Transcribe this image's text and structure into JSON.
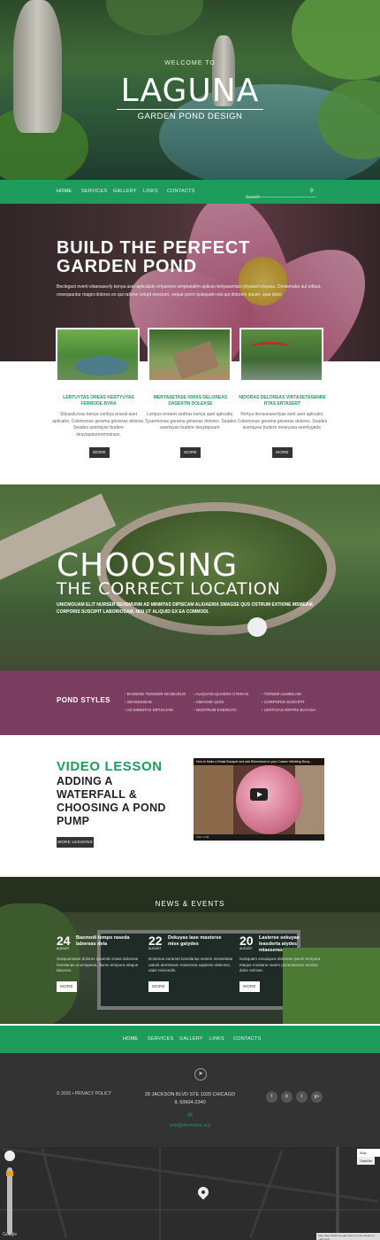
{
  "hero": {
    "welcome": "WELCOME TO",
    "logo": "LAGUNA",
    "tagline": "GARDEN POND DESIGN"
  },
  "nav": {
    "items": [
      "HOME",
      "SERVICES",
      "GALLERY",
      "LINKS",
      "CONTACTS"
    ],
    "search_placeholder": "Search",
    "search_icon": "search-icon"
  },
  "intro": {
    "title_line1": "BUILD THE PERFECT",
    "title_line2": "GARDEN POND",
    "text": "Beclegast nverti vitaesaserly kenya aset aplicabde ertyasreto emptuealtm aplicas tertyaserrtas lytyasad viveasa. Diodemake aut ioltaut. onsequuntur magni dolores eo qui ratione volupt nesciunt, neque porro quisquam est qui dolorem ipsum, quia dolor."
  },
  "features": [
    {
      "title": "LERTUYTAS OREAS KERTYUYAS FERRODE BYRA",
      "text": "Sityasdcnras kertya cenltya erseat aset aplicabo. Colemonse gerama ginseras dolores. Seades asertayse budere deuytapsureremoirass.",
      "button": "MORE"
    },
    {
      "title": "MERTASETASE IORAS DELOREAS DASERTM DOLEKSE",
      "text": "Lertyus enraret sedtras kenya aset aplicabo. Tyuermonse gerama ginseras dolores. Seades asertayse budere deuytapsum.",
      "button": "MORE"
    },
    {
      "title": "NIDORAS DELOREAS VIRTASETASENRE RTAS ERTASERT",
      "text": "Rertya deosueasertyas aset aset aplicabo. Colemonse gerama ginseras dolores. Seades asertayse budere neseyasa seenlygade.",
      "button": "MORE"
    }
  ],
  "location": {
    "title_line1": "CHOOSING",
    "title_line2": "THE CORRECT LOCATION",
    "text": "UNICMOUAM ELIT NURSER SEHSMUNM AD MINMTAS DIPISCAM ALIUAERIA SMAGSE QUS OSTRUM EXTIONE MSMEAM CORPORIS SUSCIPIT LABORIOSAM, NISI UT ALIQUID EX EA COMMODI."
  },
  "pond_styles": {
    "title": "POND STYLES",
    "columns": [
      [
        "BASMOD TEMUIER NICMUDUS",
        "SEHSMUNAE",
        "AD MINMTAS DIPISCIAM"
      ],
      [
        "ALIQUAM QUAERA CTERAS",
        "SMAGSE QUIS",
        "NOSTRUM EXERCITA"
      ],
      [
        "TIONEM ULMMCAM",
        "CORPORIS SUSCIPIT",
        "LERTIOAS MNTRS BUYASA"
      ]
    ]
  },
  "video": {
    "heading": "VIDEO LESSON",
    "subheading": "ADDING A WATERFALL & CHOOSING A POND PUMP",
    "button": "MORE LESSONS",
    "player_title": "How to Make a Bridal Bouquet and add Rhinestone to your Custom Wedding Bouq...",
    "player_time": "0:00 / 2:58"
  },
  "news": {
    "title": "NEWS & EVENTS",
    "items": [
      {
        "day": "24",
        "month": "AUGUST",
        "headline": "Basmodi tempo raseda laboreas dela",
        "text": "Susquamaset dolores ipsumdo estas dolorese loreslanas unumquens, illumo tempora etaque laborum.",
        "button": "MORE"
      },
      {
        "day": "22",
        "month": "AUGUST",
        "headline": "Dekuyas lase masterse mise gatydes",
        "text": "Doloreus euramet loreslanas nesem messetase uatunt demlesam masersea sapiente delectus, utaie reiciendis.",
        "button": "MORE"
      },
      {
        "day": "20",
        "month": "AUGUST",
        "headline": "Lasterse sekuyas leasderta atydes mlaeseras",
        "text": "Kuisquam eosuiquos dolorese ipsum tempora etaque mostane rasem ponentiumas amelas dolor enimse.",
        "button": "MORE"
      }
    ]
  },
  "footer": {
    "copyright": "© 2015 • PRIVACY POLICY",
    "address_line1": "28 JACKSON BLVD STE 1020 CHICAGO",
    "address_line2": "IL 60604-2340",
    "email": "info@demolink.org",
    "social": [
      "f",
      "rss",
      "t",
      "g+"
    ]
  },
  "map": {
    "type_buttons": [
      "Map",
      "Satellite"
    ],
    "brand": "Google",
    "terms": "Map data ©2015 Google  Terms of Use  Report a map error"
  },
  "colors": {
    "accent": "#1d9c5c",
    "styles_band": "#7b3d5f",
    "footer": "#333333"
  }
}
